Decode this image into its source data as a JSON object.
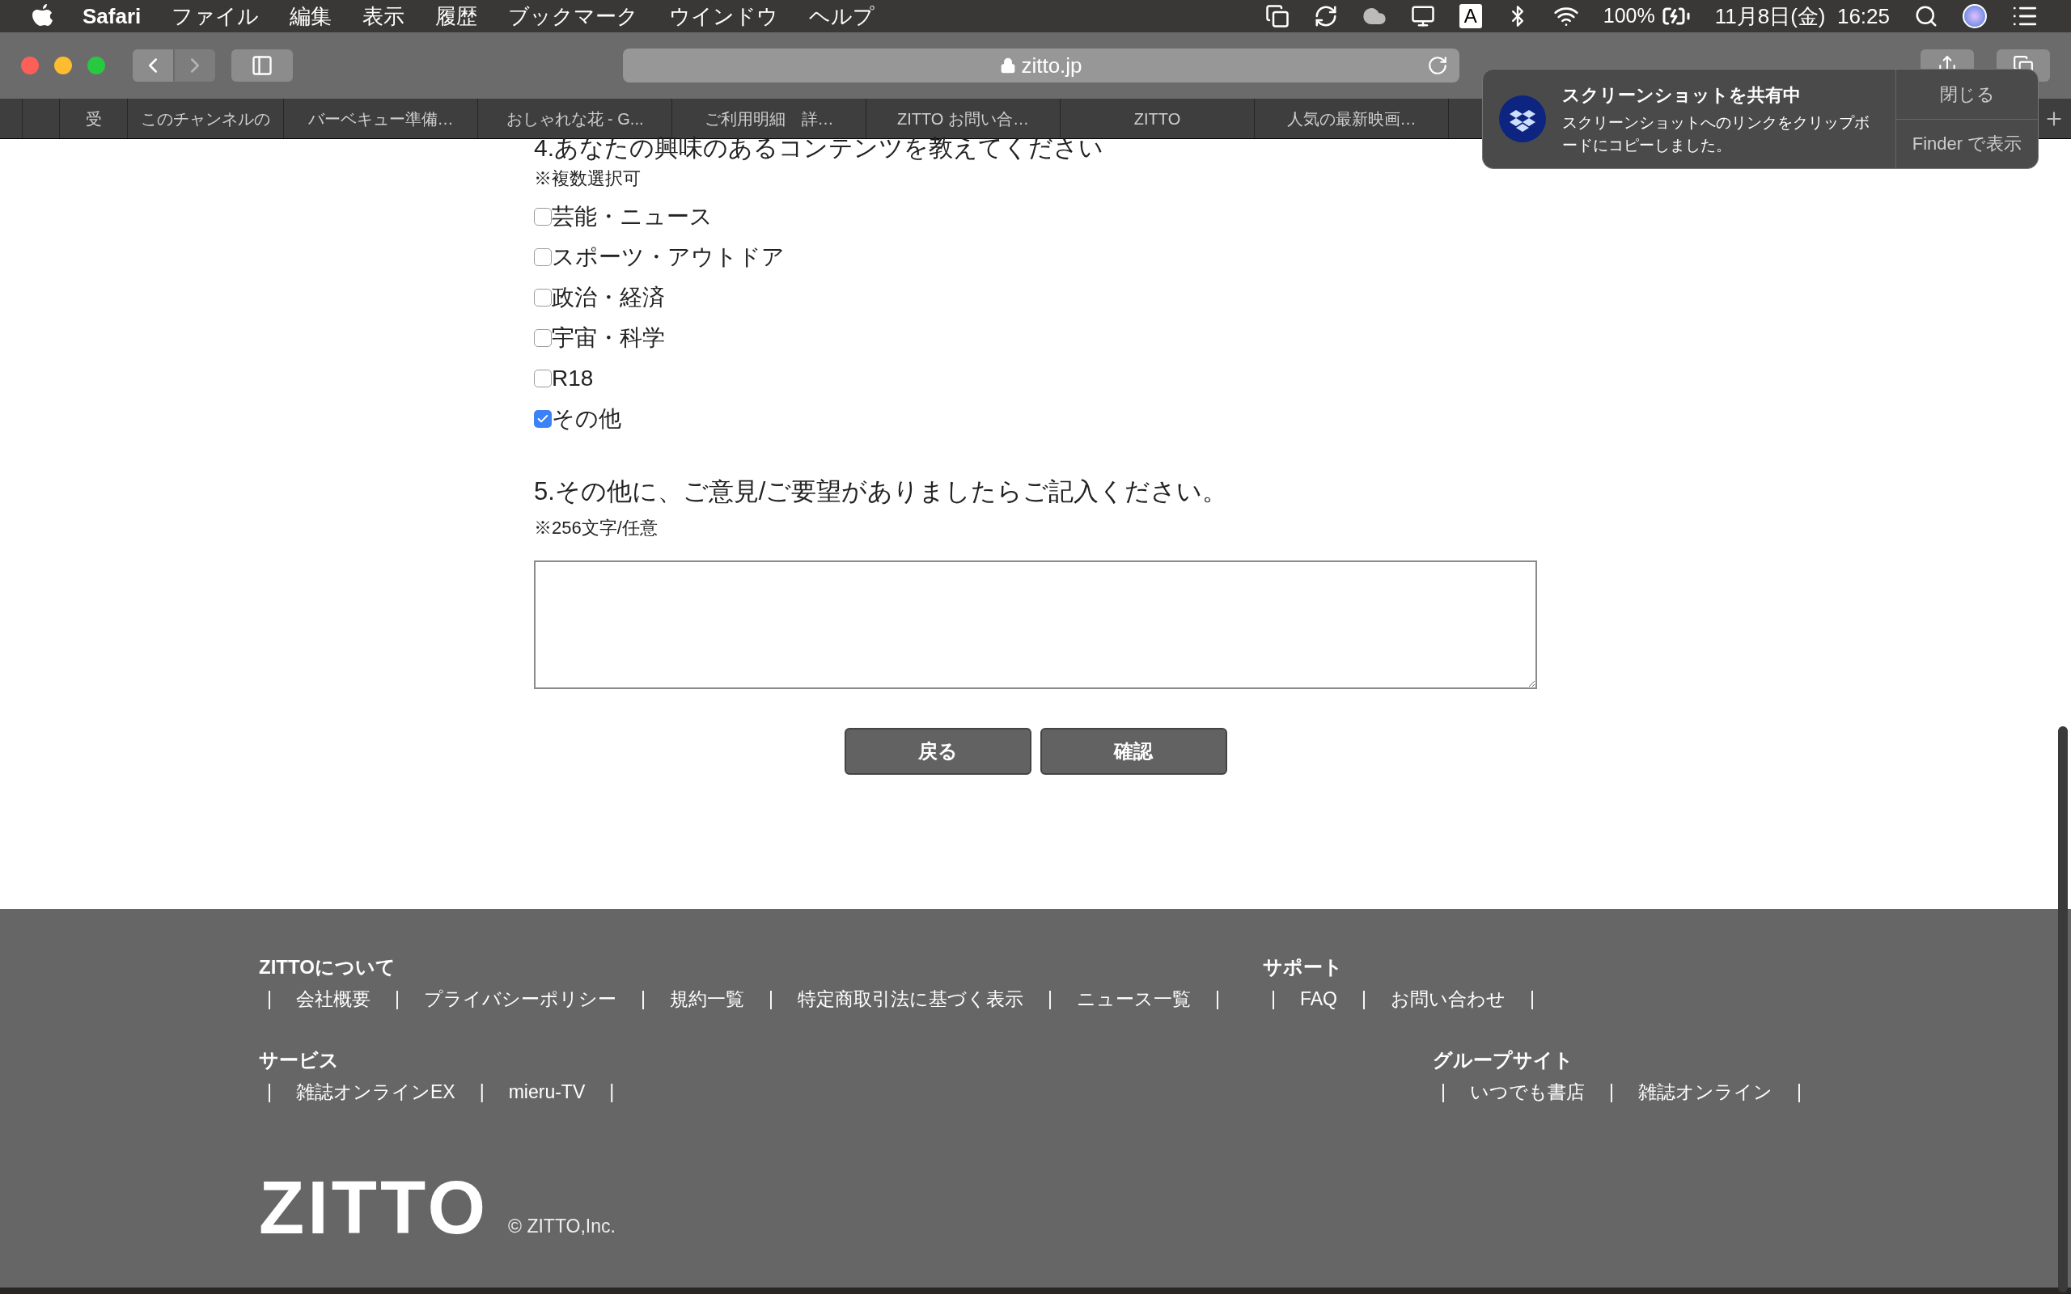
{
  "menu_bar": {
    "app": "Safari",
    "menus": [
      "ファイル",
      "編集",
      "表示",
      "履歴",
      "ブックマーク",
      "ウインドウ",
      "ヘルプ"
    ],
    "input_source": "A",
    "battery": "100%",
    "clock": "11月8日(金)  16:25"
  },
  "toolbar": {
    "url": "zitto.jp"
  },
  "tabs": [
    {
      "kind": "pinned"
    },
    {
      "kind": "pinned"
    },
    {
      "kind": "page",
      "label": "受"
    },
    {
      "kind": "page",
      "label": "このチャンネルの"
    },
    {
      "kind": "page",
      "label": "バーベキュー準備…"
    },
    {
      "kind": "page",
      "label": "おしゃれな花 - G..."
    },
    {
      "kind": "page",
      "label": "ご利用明細　詳…"
    },
    {
      "kind": "page",
      "label": "ZITTO お問い合…"
    },
    {
      "kind": "page",
      "label": "ZITTO"
    },
    {
      "kind": "page",
      "label": "人気の最新映画…"
    }
  ],
  "notification": {
    "title": "スクリーンショットを共有中",
    "body": "スクリーンショットへのリンクをクリップボードにコピーしました。",
    "actions": [
      "閉じる",
      "Finder で表示"
    ]
  },
  "form": {
    "q4": {
      "title": "4.あなたの興味のあるコンテンツを教えてください",
      "note": "※複数選択可",
      "options": [
        {
          "label": "芸能・ニュース",
          "checked": false
        },
        {
          "label": "スポーツ・アウトドア",
          "checked": false
        },
        {
          "label": "政治・経済",
          "checked": false
        },
        {
          "label": "宇宙・科学",
          "checked": false
        },
        {
          "label": "R18",
          "checked": false
        },
        {
          "label": "その他",
          "checked": true
        }
      ]
    },
    "q5": {
      "title": "5.その他に、ご意見/ご要望がありましたらご記入ください。",
      "note": "※256文字/任意"
    },
    "buttons": [
      "戻る",
      "確認"
    ]
  },
  "footer": {
    "separator": "|",
    "rows": [
      {
        "sections": [
          {
            "heading": "ZITTOについて",
            "links": [
              "会社概要",
              "プライバシーポリシー",
              "規約一覧",
              "特定商取引法に基づく表示",
              "ニュース一覧"
            ]
          },
          {
            "heading": "サポート",
            "links": [
              "FAQ",
              "お問い合わせ"
            ]
          }
        ]
      },
      {
        "sections": [
          {
            "heading": "サービス",
            "links": [
              "雑誌オンラインEX",
              "mieru-TV"
            ]
          },
          {
            "heading": "グループサイト",
            "links": [
              "いつでも書店",
              "雑誌オンライン"
            ]
          }
        ]
      }
    ],
    "logo": "ZITTO",
    "copyright": "© ZITTO,Inc."
  }
}
